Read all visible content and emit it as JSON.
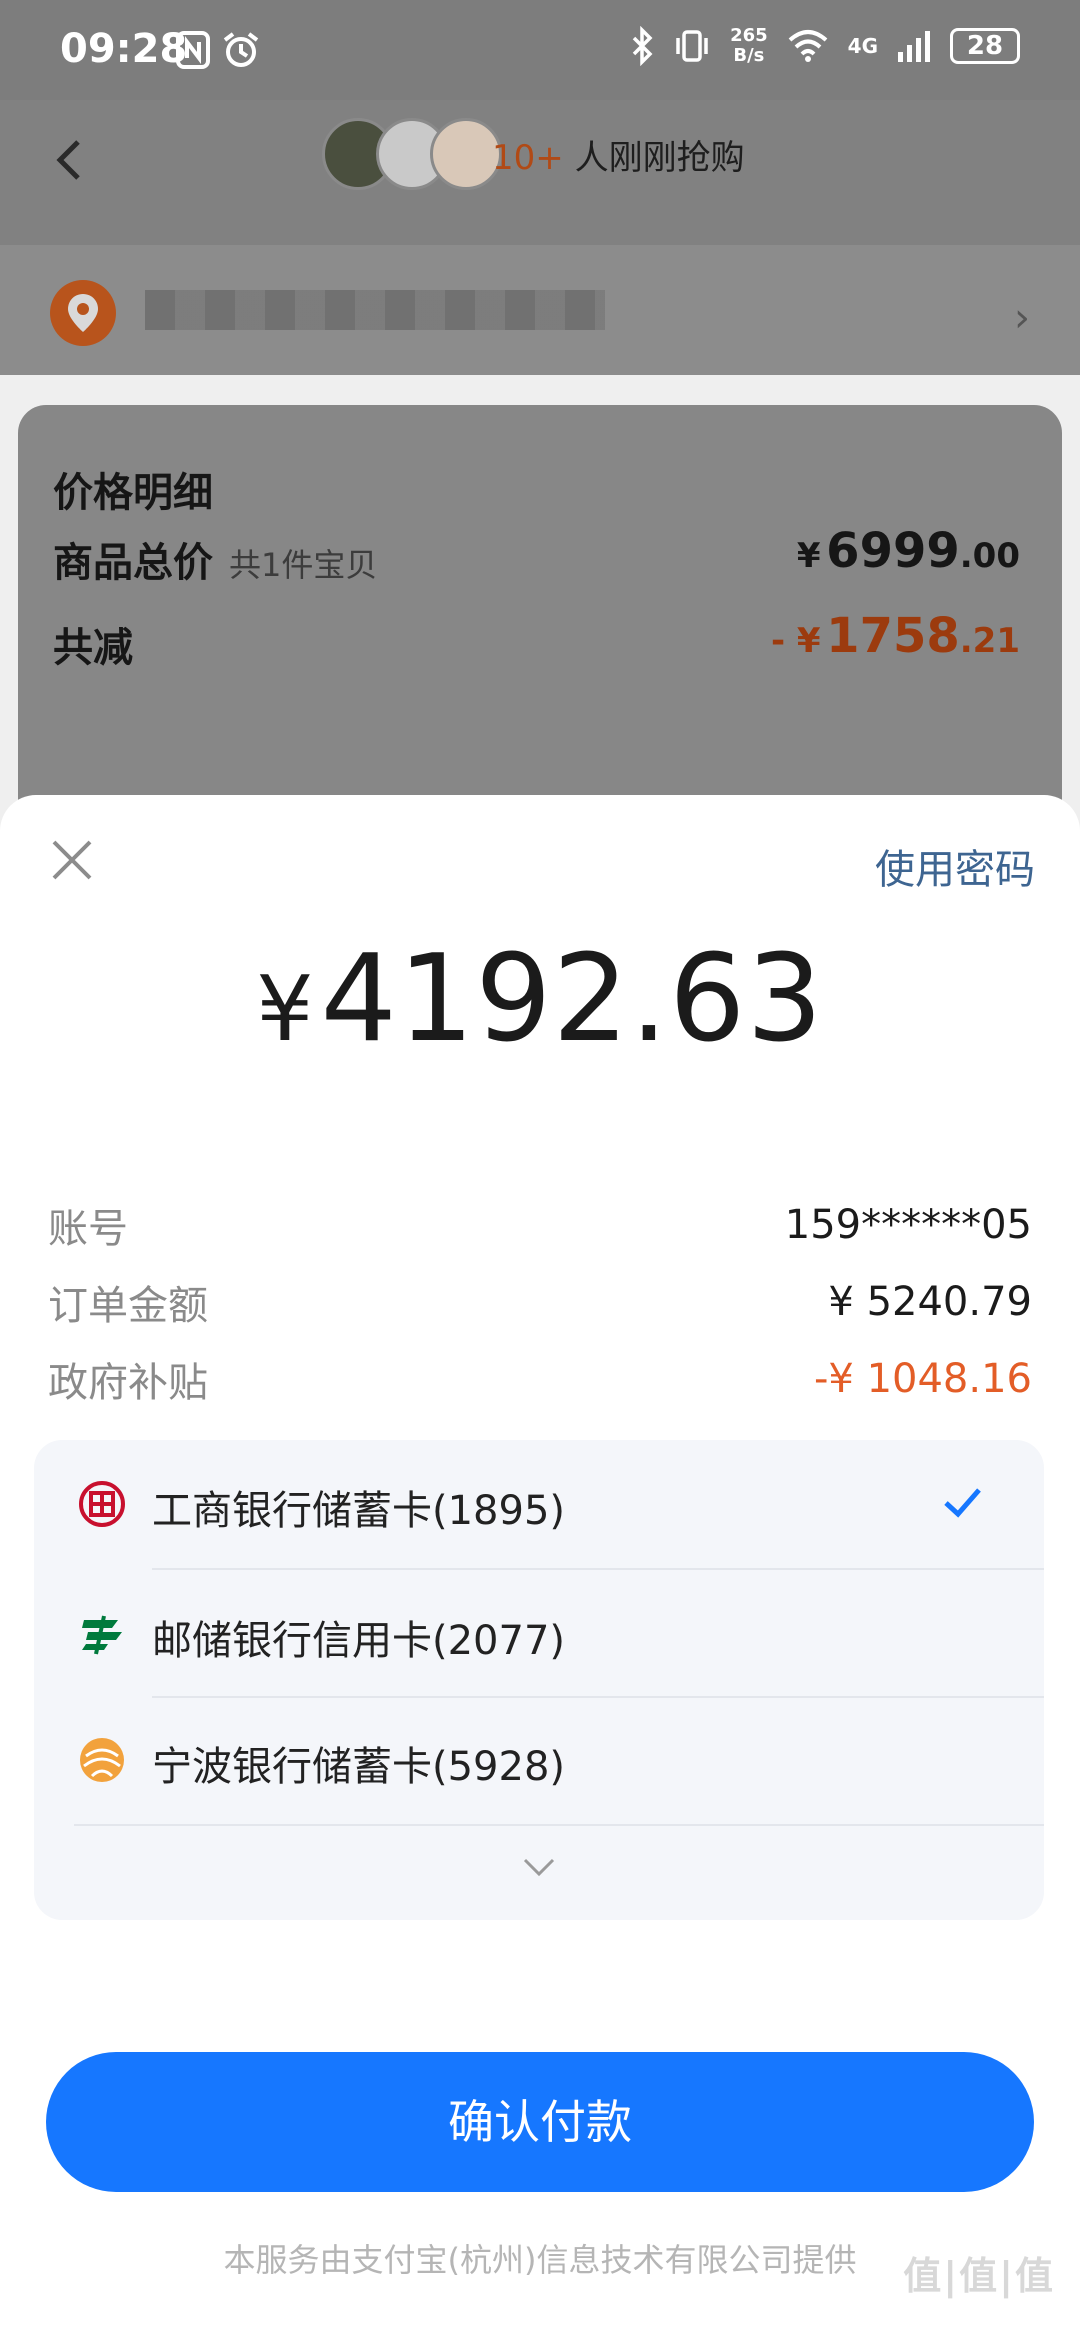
{
  "status_bar": {
    "time": "09:28",
    "net_speed_top": "265",
    "net_speed_bottom": "B/s",
    "network": "4G",
    "battery": "28"
  },
  "header": {
    "buyers_count": "10+",
    "buyers_text": " 人刚刚抢购"
  },
  "price_detail": {
    "title": "价格明细",
    "total_label": "商品总价",
    "total_sub": "共1件宝贝",
    "total_yen": "¥",
    "total_int": "6999",
    "total_dec": ".00",
    "discount_label": "共减",
    "discount_prefix": "- ¥",
    "discount_int": "1758",
    "discount_dec": ".21"
  },
  "payment_sheet": {
    "use_password": "使用密码",
    "amount_yen": "¥",
    "amount": "4192.63",
    "rows": [
      {
        "label": "账号",
        "value": "159******05"
      },
      {
        "label": "订单金额",
        "value": "¥ 5240.79"
      },
      {
        "label": "政府补贴",
        "value": "-¥ 1048.16"
      }
    ],
    "banks": [
      {
        "label": "工商银行储蓄卡(1895)",
        "icon": "icbc-icon",
        "color": "#c8102e",
        "selected": true
      },
      {
        "label": "邮储银行信用卡(2077)",
        "icon": "psbc-icon",
        "color": "#007a3d",
        "selected": false
      },
      {
        "label": "宁波银行储蓄卡(5928)",
        "icon": "nbcb-icon",
        "color": "#f2a23c",
        "selected": false
      }
    ],
    "confirm_label": "确认付款",
    "footer_note": "本服务由支付宝(杭州)信息技术有限公司提供"
  },
  "watermark": "值|值|值",
  "colors": {
    "primary_blue": "#1677ff",
    "link_blue": "#3e6591",
    "subsidy_red": "#e35d27"
  }
}
